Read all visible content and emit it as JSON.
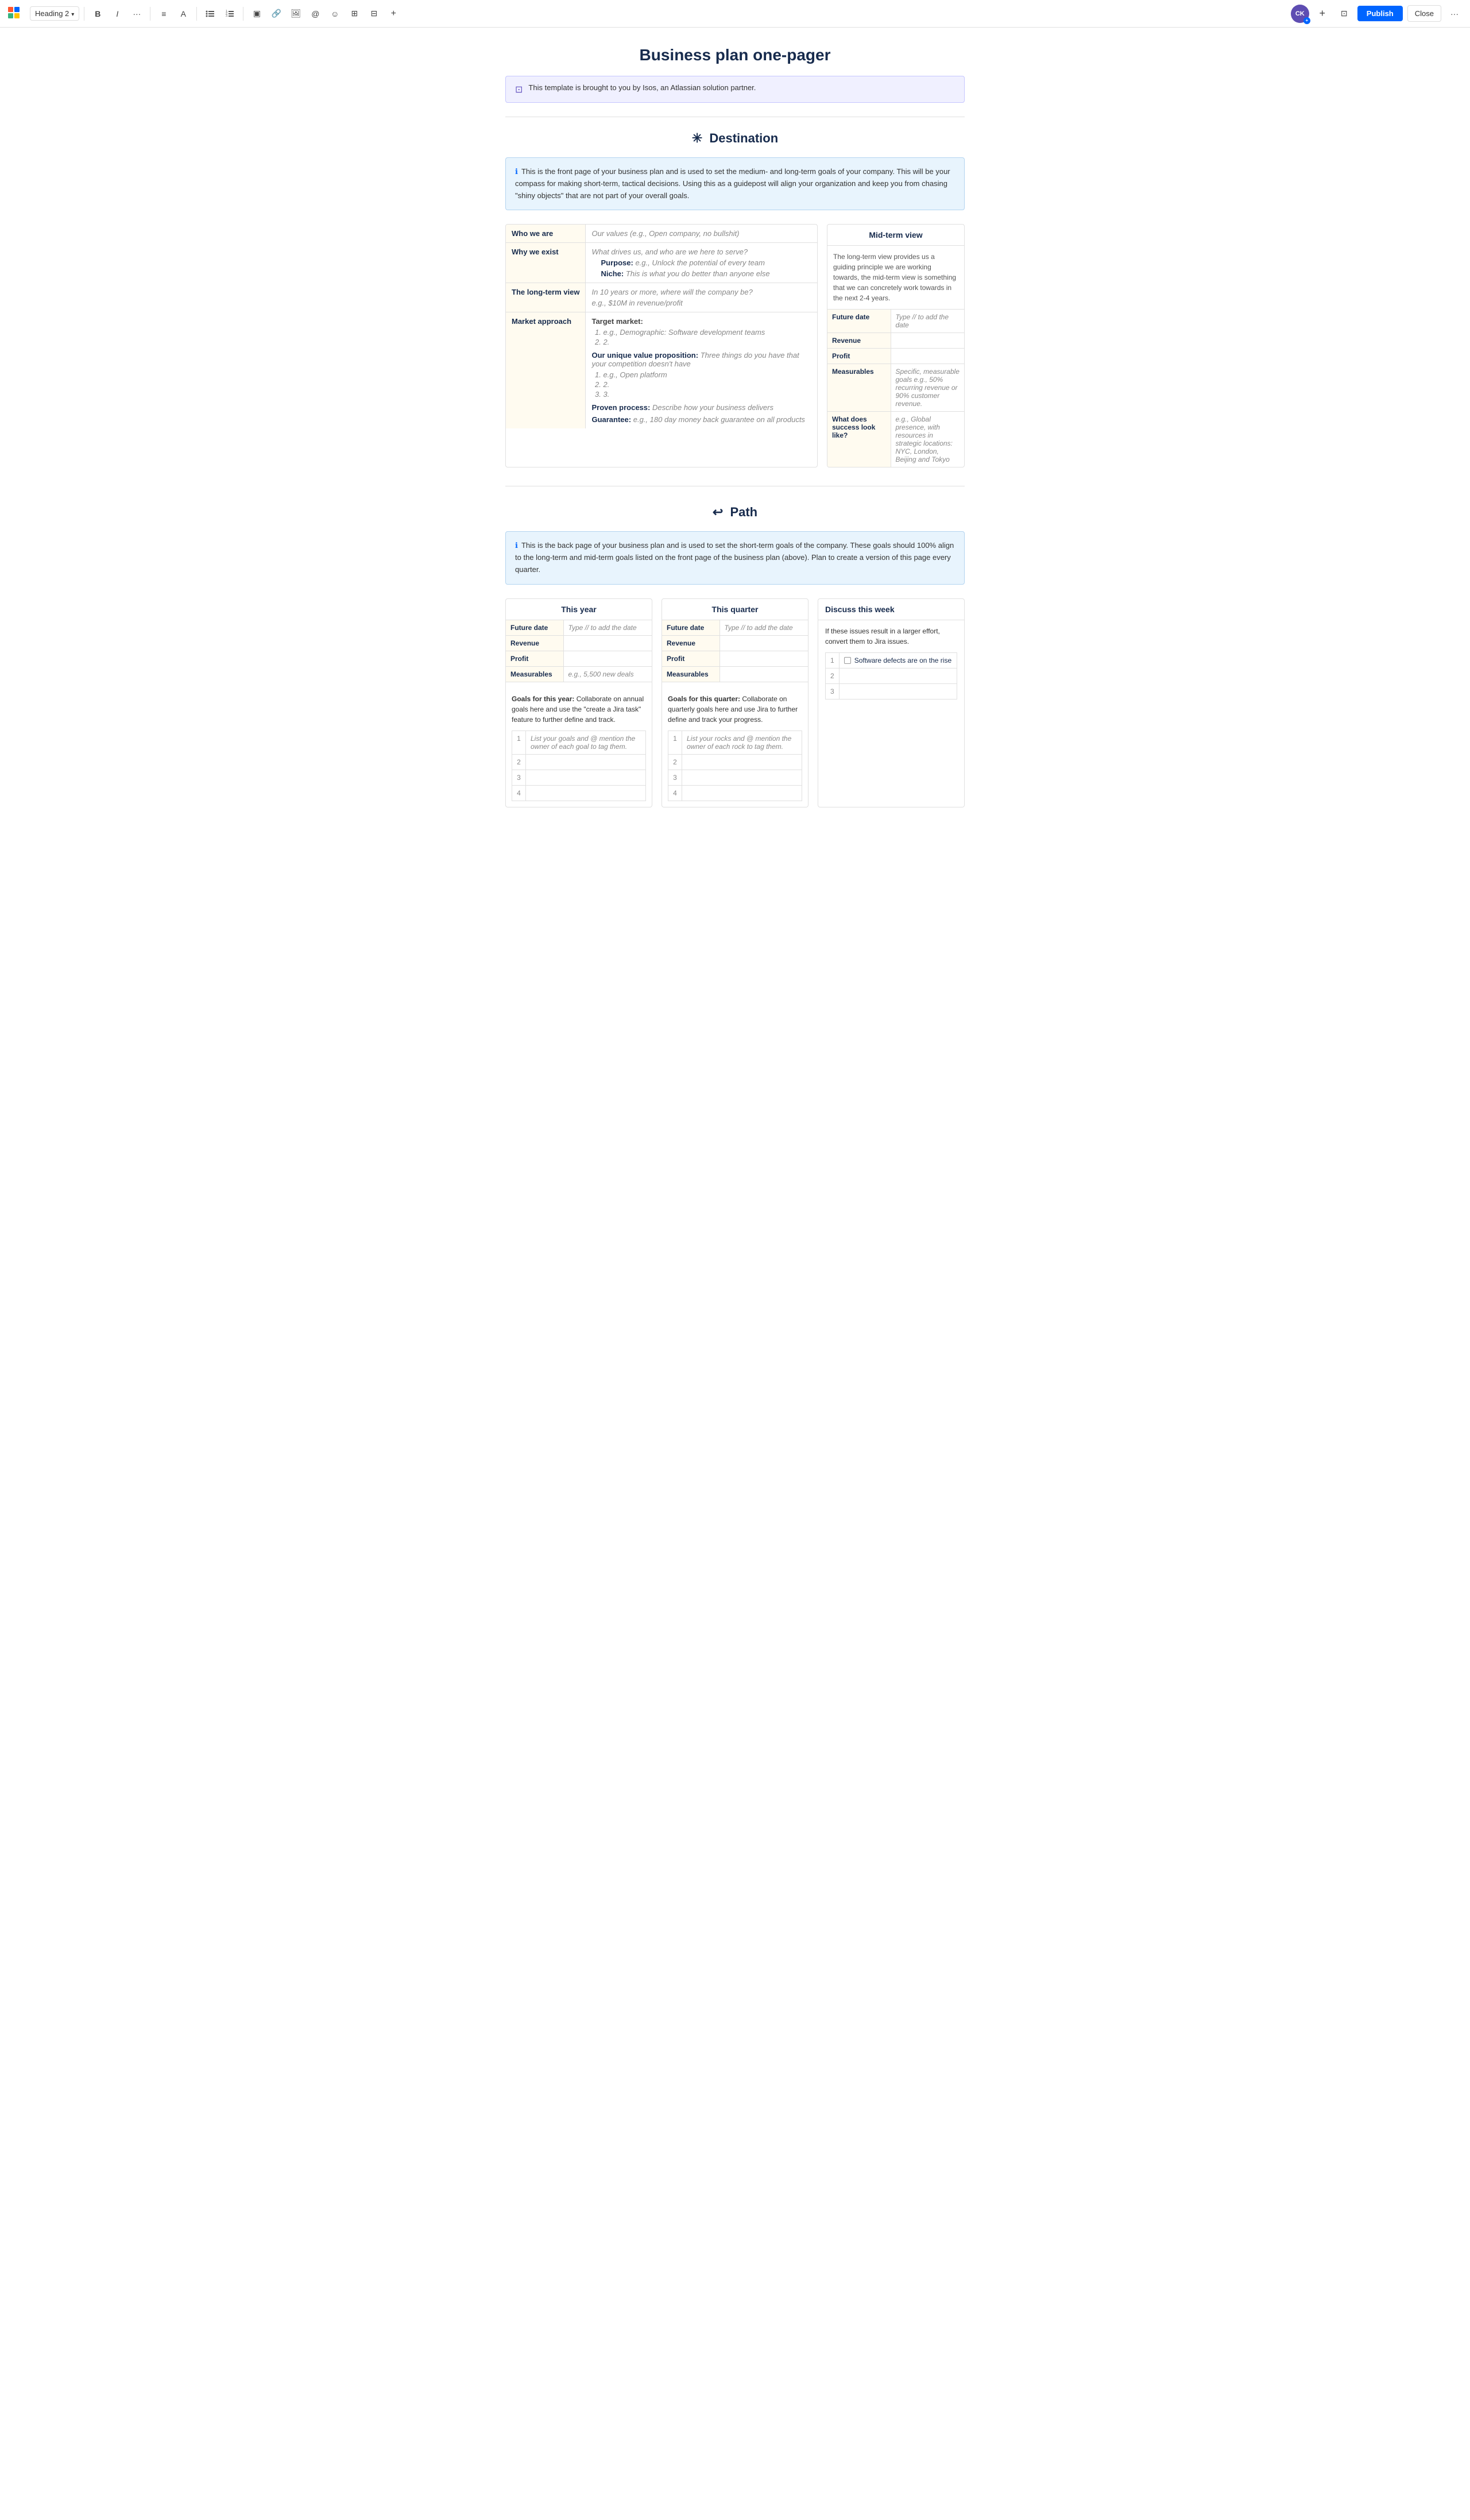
{
  "toolbar": {
    "logo_label": "✕",
    "heading_label": "Heading 2",
    "bold_label": "B",
    "italic_label": "I",
    "more_label": "···",
    "align_label": "≡",
    "color_label": "A",
    "bullet_label": "☰",
    "numbered_label": "☰",
    "box_label": "▣",
    "link_label": "🔗",
    "image_label": "🖼",
    "mention_label": "@",
    "emoji_label": "☺",
    "table_label": "⊞",
    "layout_label": "⊟",
    "plus_label": "+",
    "avatar_label": "CK",
    "plus_btn_label": "+",
    "template_label": "⊡",
    "close_label": "Close",
    "more_right_label": "···",
    "publish_label": "Publish"
  },
  "page": {
    "title": "Business plan one-pager",
    "template_notice": "This template is brought to you by Isos, an Atlassian solution partner."
  },
  "destination": {
    "heading": "Destination",
    "heading_icon": "✳",
    "info_text": "This is the front page of your business plan and is used to set the medium- and long-term goals of your company. This will be your compass for making short-term, tactical decisions. Using this as a guidepost will align your organization and keep you from chasing \"shiny objects\" that are not part of your overall goals.",
    "table": {
      "rows": [
        {
          "label": "Who we are",
          "value": "Our values (e.g., Open company, no bullshit)"
        },
        {
          "label": "Why we exist",
          "value_lines": [
            "What drives us, and who are we here to serve?",
            "Purpose: e.g., Unlock the potential of every team",
            "Niche: This is what you do better than anyone else"
          ]
        },
        {
          "label": "The long-term view",
          "value_lines": [
            "In 10 years or more, where will the company be?",
            "e.g., $10M in revenue/profit"
          ]
        },
        {
          "label": "Market approach",
          "value_complex": true
        }
      ],
      "market_target": "Target market:",
      "market_item1": "e.g., Demographic: Software development teams",
      "market_item2": "2.",
      "market_uvp": "Our unique value proposition:",
      "market_uvp_desc": "Three things do you have that your competition doesn't have",
      "market_uvp1": "e.g., Open platform",
      "market_uvp2": "2.",
      "market_uvp3": "3.",
      "market_process": "Proven process:",
      "market_process_desc": "Describe how your business delivers",
      "market_guarantee": "Guarantee:",
      "market_guarantee_desc": "e.g., 180 day money back guarantee on all products"
    },
    "midterm": {
      "title": "Mid-term view",
      "desc": "The long-term view provides us a guiding principle we are working towards, the mid-term view is something that we can concretely work towards in the next 2-4 years.",
      "rows": [
        {
          "label": "Future date",
          "value": "Type // to add the date"
        },
        {
          "label": "Revenue",
          "value": ""
        },
        {
          "label": "Profit",
          "value": ""
        },
        {
          "label": "Measurables",
          "value": "Specific, measurable goals e.g., 50% recurring revenue or 90% customer revenue."
        },
        {
          "label": "What does success look like?",
          "value": "e.g., Global presence, with resources in strategic locations: NYC, London, Beijing and Tokyo"
        }
      ]
    }
  },
  "path": {
    "heading": "Path",
    "heading_icon": "↩",
    "info_text": "This is the back page of your business plan and is used to set the short-term goals of the company. These goals should 100% align to the long-term and mid-term goals listed on the front page of the business plan (above). Plan to create a version of this page every quarter.",
    "this_year": {
      "title": "This year",
      "rows": [
        {
          "label": "Future date",
          "value": "Type // to add the date"
        },
        {
          "label": "Revenue",
          "value": ""
        },
        {
          "label": "Profit",
          "value": ""
        },
        {
          "label": "Measurables",
          "value": "e.g., 5,500 new deals"
        }
      ],
      "goals_label": "Goals for this year:",
      "goals_desc": "Collaborate on annual goals here and use the \"create a Jira task\" feature to further define and track.",
      "goal_rows": [
        {
          "num": "1",
          "text": "List your goals and @ mention the owner of each goal to tag them."
        },
        {
          "num": "2",
          "text": ""
        },
        {
          "num": "3",
          "text": ""
        },
        {
          "num": "4",
          "text": ""
        }
      ]
    },
    "this_quarter": {
      "title": "This quarter",
      "rows": [
        {
          "label": "Future date",
          "value": "Type // to add the date"
        },
        {
          "label": "Revenue",
          "value": ""
        },
        {
          "label": "Profit",
          "value": ""
        },
        {
          "label": "Measurables",
          "value": ""
        }
      ],
      "goals_label": "Goals for this quarter:",
      "goals_desc": "Collaborate on quarterly goals here and use Jira to further define and track your progress.",
      "goal_rows": [
        {
          "num": "1",
          "text": "List your rocks and @ mention the owner of each rock to tag them."
        },
        {
          "num": "2",
          "text": ""
        },
        {
          "num": "3",
          "text": ""
        },
        {
          "num": "4",
          "text": ""
        }
      ]
    },
    "discuss": {
      "title": "Discuss this week",
      "desc": "If these issues result in a larger effort, convert them to Jira issues.",
      "items": [
        {
          "num": "1",
          "text": "Software defects are on the rise",
          "checked": false
        },
        {
          "num": "2",
          "text": ""
        },
        {
          "num": "3",
          "text": ""
        }
      ]
    }
  }
}
